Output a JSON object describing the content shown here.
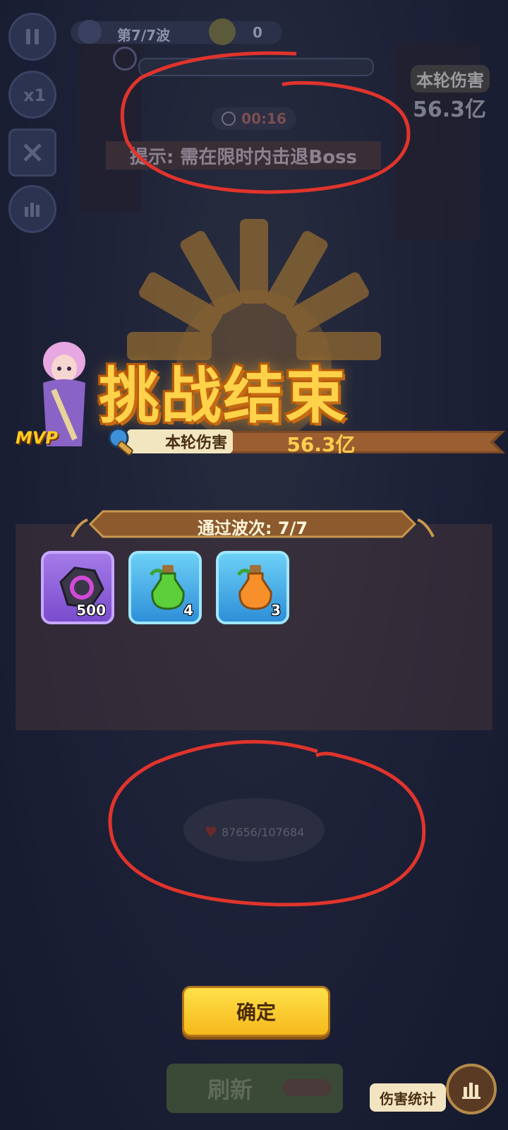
{
  "hud": {
    "wave_label": "第7/7波",
    "score": "0",
    "timer": "00:16",
    "hint": "提示: 需在限时内击退Boss",
    "round_damage_label": "本轮伤害",
    "round_damage_value": "56.3亿"
  },
  "result": {
    "title": "挑战结束",
    "mvp_label": "MVP",
    "damage_label": "本轮伤害",
    "damage_value": "56.3亿",
    "waves_passed": "通过波次: 7/7",
    "rewards": [
      {
        "icon": "purple-ore-icon",
        "count": "500"
      },
      {
        "icon": "green-potion-icon",
        "count": "4"
      },
      {
        "icon": "orange-potion-icon",
        "count": "3"
      }
    ],
    "confirm_label": "确定"
  },
  "boss": {
    "hp": "87656/107684"
  },
  "bottom": {
    "refresh_label": "刷新",
    "damage_stats_label": "伤害统计"
  },
  "colors": {
    "annotation": "#e0342c",
    "title": "#ffd24a",
    "confirm": "#f5c026"
  }
}
